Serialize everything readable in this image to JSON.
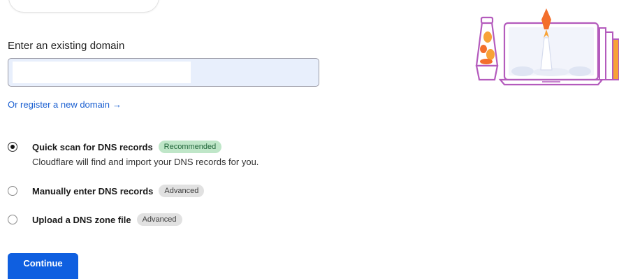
{
  "form": {
    "domain_label": "Enter an existing domain",
    "domain_value": "",
    "register_link": "Or register a new domain",
    "register_arrow": "→"
  },
  "scan_options": [
    {
      "title": "Quick scan for DNS records",
      "badge": "Recommended",
      "description": "Cloudflare will find and import your DNS records for you.",
      "selected": true
    },
    {
      "title": "Manually enter DNS records",
      "badge": "Advanced",
      "selected": false
    },
    {
      "title": "Upload a DNS zone file",
      "badge": "Advanced",
      "selected": false
    }
  ],
  "actions": {
    "continue_label": "Continue"
  },
  "colors": {
    "primary": "#0f5fe0",
    "link": "#1a5fd1",
    "recommended_badge_bg": "#bfe6c8",
    "advanced_badge_bg": "#e1e1e1",
    "input_bg": "#e8effc"
  },
  "illustration": {
    "icon": "laptop-rocket-lava-lamp-icon"
  }
}
